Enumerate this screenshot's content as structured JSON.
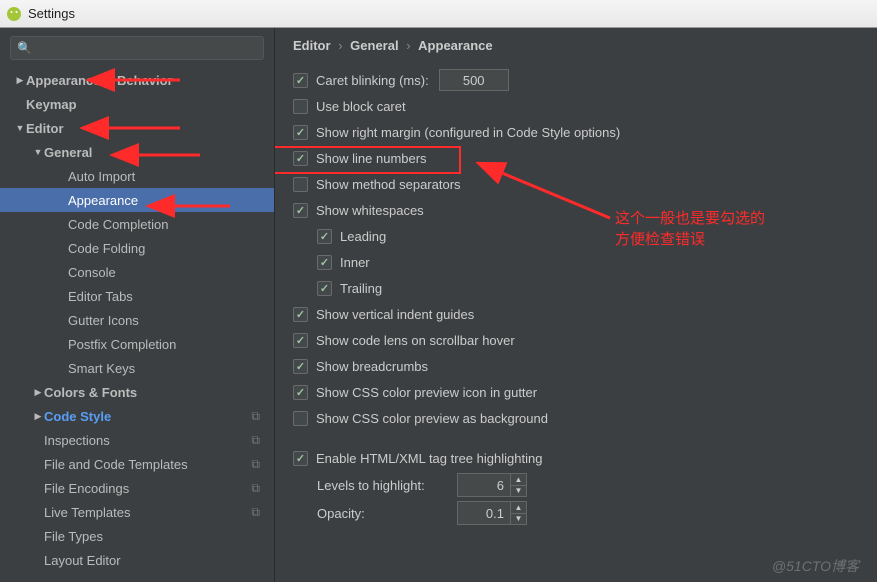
{
  "window": {
    "title": "Settings"
  },
  "search": {
    "placeholder": ""
  },
  "sidebar": {
    "items": [
      {
        "label": "Appearance & Behavior",
        "lvl": 0,
        "arrow": "right",
        "bold": true
      },
      {
        "label": "Keymap",
        "lvl": 0,
        "arrow": "",
        "bold": true
      },
      {
        "label": "Editor",
        "lvl": 0,
        "arrow": "down",
        "bold": true
      },
      {
        "label": "General",
        "lvl": 1,
        "arrow": "down",
        "bold": true
      },
      {
        "label": "Auto Import",
        "lvl": 2
      },
      {
        "label": "Appearance",
        "lvl": 2,
        "selected": true
      },
      {
        "label": "Code Completion",
        "lvl": 2
      },
      {
        "label": "Code Folding",
        "lvl": 2
      },
      {
        "label": "Console",
        "lvl": 2
      },
      {
        "label": "Editor Tabs",
        "lvl": 2
      },
      {
        "label": "Gutter Icons",
        "lvl": 2
      },
      {
        "label": "Postfix Completion",
        "lvl": 2
      },
      {
        "label": "Smart Keys",
        "lvl": 2
      },
      {
        "label": "Colors & Fonts",
        "lvl": 1,
        "arrow": "right",
        "bold": true
      },
      {
        "label": "Code Style",
        "lvl": 1,
        "arrow": "right",
        "bold": true,
        "link": true,
        "copy": true
      },
      {
        "label": "Inspections",
        "lvl": 1,
        "copy": true
      },
      {
        "label": "File and Code Templates",
        "lvl": 1,
        "copy": true
      },
      {
        "label": "File Encodings",
        "lvl": 1,
        "copy": true
      },
      {
        "label": "Live Templates",
        "lvl": 1,
        "copy": true
      },
      {
        "label": "File Types",
        "lvl": 1
      },
      {
        "label": "Layout Editor",
        "lvl": 1
      }
    ]
  },
  "breadcrumb": [
    "Editor",
    "General",
    "Appearance"
  ],
  "options": [
    {
      "label": "Caret blinking (ms):",
      "checked": true,
      "input": "500"
    },
    {
      "label": "Use block caret",
      "checked": false
    },
    {
      "label": "Show right margin (configured in Code Style options)",
      "checked": true
    },
    {
      "label": "Show line numbers",
      "checked": true,
      "boxed": true
    },
    {
      "label": "Show method separators",
      "checked": false
    },
    {
      "label": "Show whitespaces",
      "checked": true
    },
    {
      "label": "Leading",
      "checked": true,
      "indent": 1
    },
    {
      "label": "Inner",
      "checked": true,
      "indent": 1
    },
    {
      "label": "Trailing",
      "checked": true,
      "indent": 1
    },
    {
      "label": "Show vertical indent guides",
      "checked": true
    },
    {
      "label": "Show code lens on scrollbar hover",
      "checked": true
    },
    {
      "label": "Show breadcrumbs",
      "checked": true
    },
    {
      "label": "Show CSS color preview icon in gutter",
      "checked": true
    },
    {
      "label": "Show CSS color preview as background",
      "checked": false
    }
  ],
  "tagtree": {
    "enable_label": "Enable HTML/XML tag tree highlighting",
    "enable_checked": true,
    "levels_label": "Levels to highlight:",
    "levels_value": "6",
    "opacity_label": "Opacity:",
    "opacity_value": "0.1"
  },
  "annotation": {
    "line1": "这个一般也是要勾选的",
    "line2": "方便检查错误"
  },
  "watermark": "@51CTO博客"
}
